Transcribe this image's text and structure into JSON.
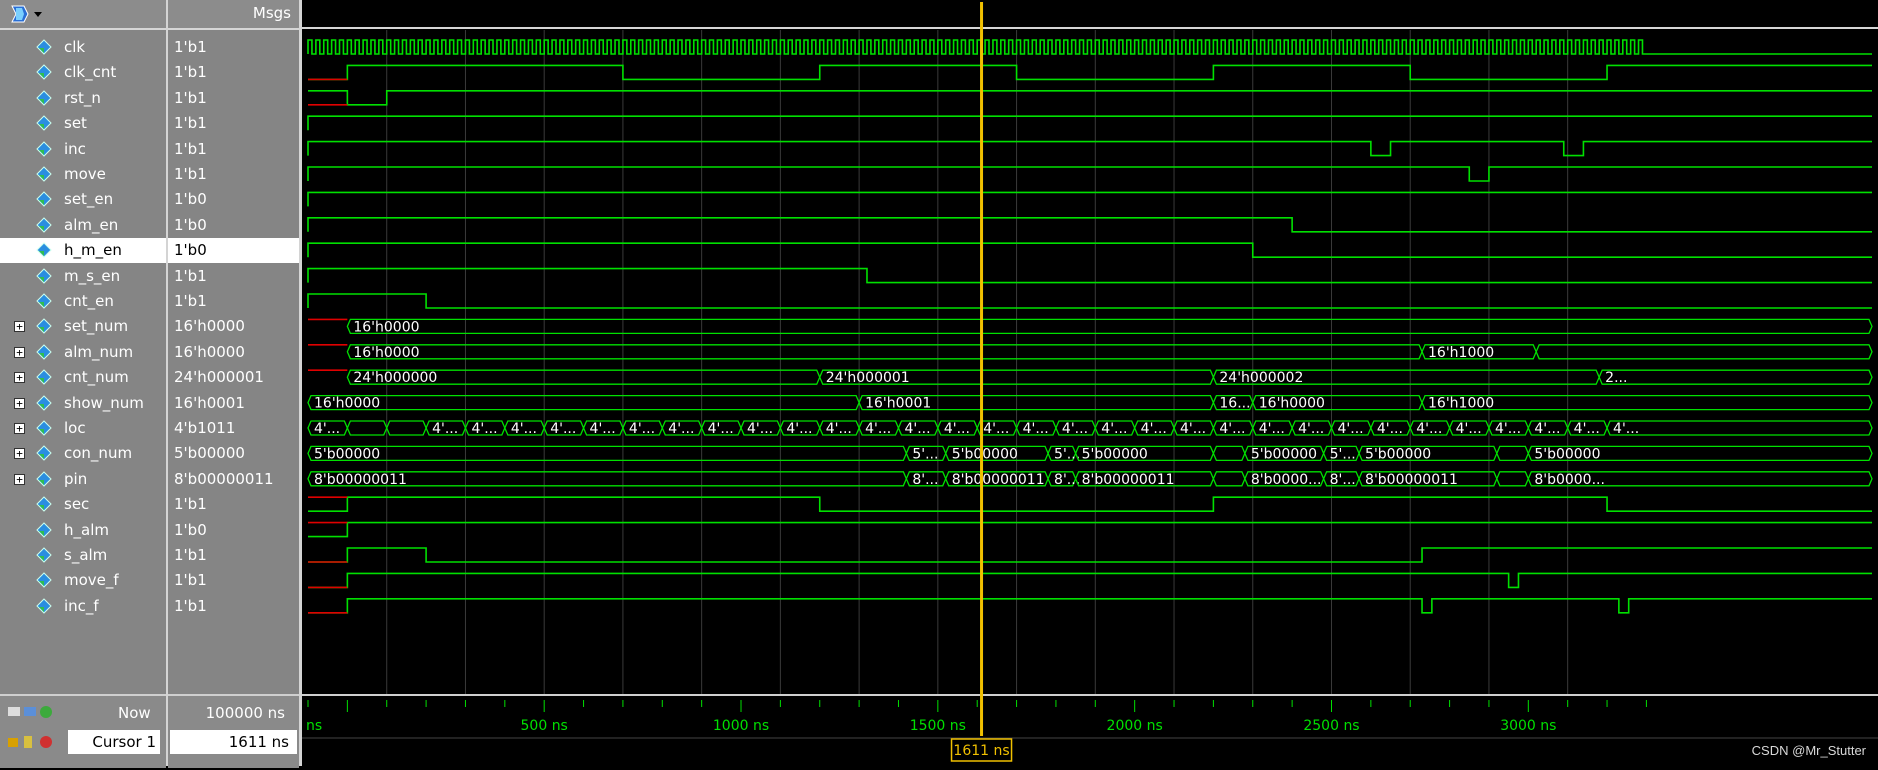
{
  "header": {
    "values_title": "Msgs"
  },
  "signals": [
    {
      "name": "clk",
      "value": "1'b1",
      "expandable": false
    },
    {
      "name": "clk_cnt",
      "value": "1'b1",
      "expandable": false
    },
    {
      "name": "rst_n",
      "value": "1'b1",
      "expandable": false
    },
    {
      "name": "set",
      "value": "1'b1",
      "expandable": false
    },
    {
      "name": "inc",
      "value": "1'b1",
      "expandable": false
    },
    {
      "name": "move",
      "value": "1'b1",
      "expandable": false
    },
    {
      "name": "set_en",
      "value": "1'b0",
      "expandable": false
    },
    {
      "name": "alm_en",
      "value": "1'b0",
      "expandable": false
    },
    {
      "name": "h_m_en",
      "value": "1'b0",
      "expandable": false,
      "selected": true
    },
    {
      "name": "m_s_en",
      "value": "1'b1",
      "expandable": false
    },
    {
      "name": "cnt_en",
      "value": "1'b1",
      "expandable": false
    },
    {
      "name": "set_num",
      "value": "16'h0000",
      "expandable": true
    },
    {
      "name": "alm_num",
      "value": "16'h0000",
      "expandable": true
    },
    {
      "name": "cnt_num",
      "value": "24'h000001",
      "expandable": true
    },
    {
      "name": "show_num",
      "value": "16'h0001",
      "expandable": true
    },
    {
      "name": "loc",
      "value": "4'b1011",
      "expandable": true
    },
    {
      "name": "con_num",
      "value": "5'b00000",
      "expandable": true
    },
    {
      "name": "pin",
      "value": "8'b00000011",
      "expandable": true
    },
    {
      "name": "sec",
      "value": "1'b1",
      "expandable": false
    },
    {
      "name": "h_alm",
      "value": "1'b0",
      "expandable": false
    },
    {
      "name": "s_alm",
      "value": "1'b1",
      "expandable": false
    },
    {
      "name": "move_f",
      "value": "1'b1",
      "expandable": false
    },
    {
      "name": "inc_f",
      "value": "1'b1",
      "expandable": false
    }
  ],
  "bus_labels": {
    "set_num": [
      {
        "t": 0,
        "label": "16'h0000"
      }
    ],
    "alm_num": [
      {
        "t": 0,
        "label": "16'h0000"
      },
      {
        "t": 2730,
        "label": "16'h1000"
      },
      {
        "t": 3020,
        "label": ""
      }
    ],
    "cnt_num": [
      {
        "t": 0,
        "label": "24'h000000"
      },
      {
        "t": 1200,
        "label": "24'h000001"
      },
      {
        "t": 2200,
        "label": "24'h000002"
      },
      {
        "t": 3180,
        "label": "2..."
      }
    ],
    "show_num": [
      {
        "t": -100,
        "label": "16'h0000"
      },
      {
        "t": 1300,
        "label": "16'h0001"
      },
      {
        "t": 2200,
        "label": "16..."
      },
      {
        "t": 2300,
        "label": "16'h0000"
      },
      {
        "t": 2730,
        "label": "16'h1000"
      }
    ],
    "con_num": [
      {
        "t": -100,
        "label": "5'b00000"
      },
      {
        "t": 1420,
        "label": "5'..."
      },
      {
        "t": 1520,
        "label": "5'b00000"
      },
      {
        "t": 1780,
        "label": "5'..."
      },
      {
        "t": 1850,
        "label": "5'b00000"
      },
      {
        "t": 2200,
        "label": ""
      },
      {
        "t": 2280,
        "label": "5'b00000"
      },
      {
        "t": 2480,
        "label": "5'..."
      },
      {
        "t": 2570,
        "label": "5'b00000"
      },
      {
        "t": 2920,
        "label": ""
      },
      {
        "t": 3000,
        "label": "5'b00000"
      }
    ],
    "pin": [
      {
        "t": -100,
        "label": "8'b00000011"
      },
      {
        "t": 1420,
        "label": "8'..."
      },
      {
        "t": 1520,
        "label": "8'b00000011"
      },
      {
        "t": 1780,
        "label": "8'..."
      },
      {
        "t": 1850,
        "label": "8'b00000011"
      },
      {
        "t": 2200,
        "label": ""
      },
      {
        "t": 2280,
        "label": "8'b0000..."
      },
      {
        "t": 2480,
        "label": "8'..."
      },
      {
        "t": 2570,
        "label": "8'b00000011"
      },
      {
        "t": 2920,
        "label": ""
      },
      {
        "t": 3000,
        "label": "8'b0000..."
      }
    ]
  },
  "loc_label": "4'...",
  "timeline": {
    "now_label": "Now",
    "now_value": "100000 ns",
    "cursor_label": "Cursor 1",
    "cursor_value": "1611 ns",
    "cursor_time": 1611,
    "ticks": [
      "500 ns",
      "1000 ns",
      "1500 ns",
      "2000 ns",
      "2500 ns",
      "3000 ns"
    ],
    "first_tick_partial": "ns"
  },
  "colors": {
    "wave": "#00e000",
    "reset": "#e00000",
    "cursor": "#f0c000",
    "grid": "#3a3a3a"
  },
  "watermark": "CSDN @Mr_Stutter"
}
